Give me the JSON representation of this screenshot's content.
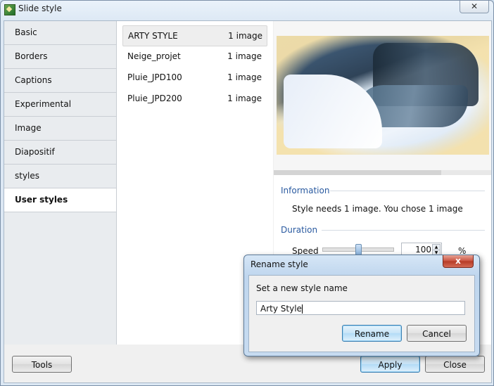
{
  "window": {
    "title": "Slide style",
    "close_label": "✕"
  },
  "sidebar": {
    "items": [
      {
        "label": "Basic"
      },
      {
        "label": "Borders"
      },
      {
        "label": "Captions"
      },
      {
        "label": "Experimental"
      },
      {
        "label": "Image"
      },
      {
        "label": "Diapositif"
      },
      {
        "label": "styles"
      },
      {
        "label": "User styles",
        "active": true
      }
    ]
  },
  "styles_list": {
    "rows": [
      {
        "name": "ARTY STYLE",
        "count": "1 image",
        "selected": true
      },
      {
        "name": "Neige_projet",
        "count": "1 image"
      },
      {
        "name": "Pluie_JPD100",
        "count": "1 image"
      },
      {
        "name": "Pluie_JPD200",
        "count": "1 image"
      }
    ]
  },
  "preview": {
    "progress": 0.77
  },
  "information": {
    "heading": "Information",
    "text": "Style needs 1 image. You chose 1 image"
  },
  "duration": {
    "heading": "Duration",
    "speed_label": "Speed",
    "speed_value": "100",
    "speed_unit": "%",
    "slider_level": 0.5
  },
  "footer": {
    "tools_label": "Tools",
    "apply_label": "Apply",
    "close_label": "Close"
  },
  "rename_dialog": {
    "title": "Rename style",
    "close_label": "x",
    "prompt": "Set a new style name",
    "input_value": "Arty Style",
    "rename_label": "Rename",
    "cancel_label": "Cancel"
  },
  "colors": {
    "section_heading": "#2a5aa0",
    "dialog_close": "#c8503d"
  }
}
